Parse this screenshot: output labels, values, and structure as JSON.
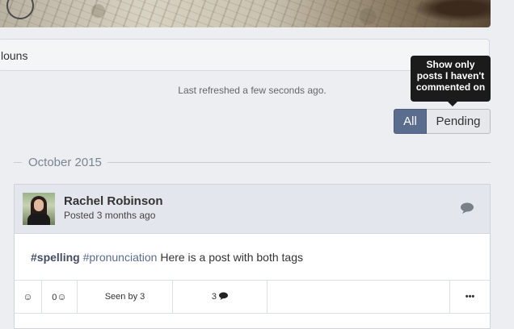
{
  "community": {
    "name_fragment": "louns"
  },
  "feed": {
    "last_refreshed": "Last refreshed a few seconds ago.",
    "filter_tooltip": "Show only posts I haven't commented on",
    "filter_all_label": "All",
    "filter_pending_label": "Pending",
    "month_heading": "October 2015"
  },
  "post": {
    "author": "Rachel Robinson",
    "posted": "Posted 3 months ago",
    "tag1": "#spelling",
    "tag2": "#pronunciation",
    "text": " Here is a post with both tags",
    "react_icon": "☺",
    "reaction_count": "0",
    "reaction_count_icon": "☺",
    "seen_by": "Seen by 3",
    "comment_count": "3",
    "more_label": "•••"
  }
}
